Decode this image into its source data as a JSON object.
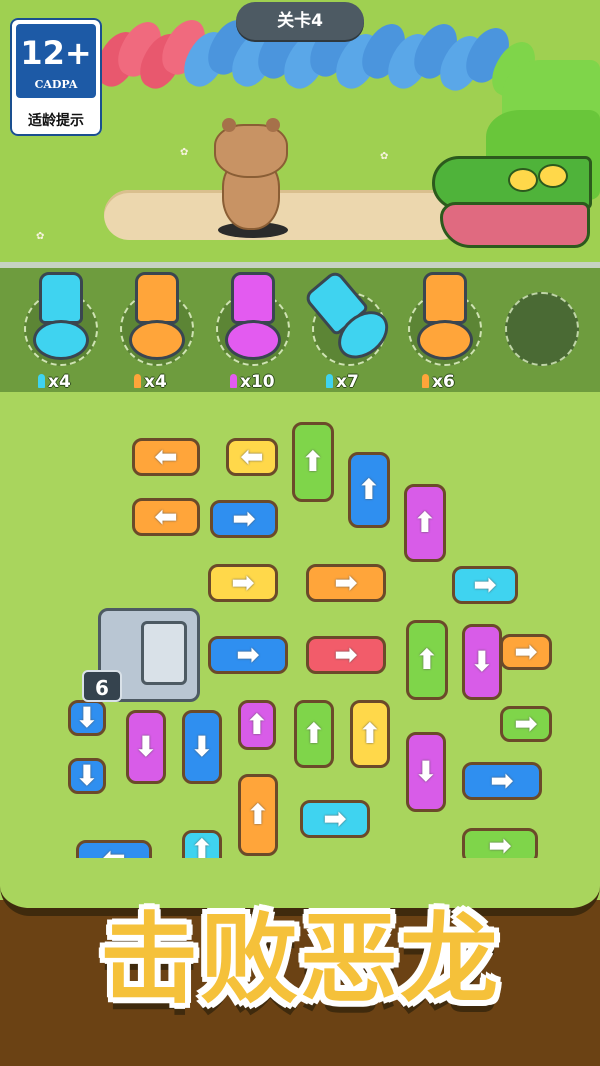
{
  "level_label": "关卡4",
  "age_badge": {
    "number": "12+",
    "org": "CADPA",
    "text": "适龄提示"
  },
  "cannons": [
    {
      "color": "#3fd3f0",
      "ammo": "x4"
    },
    {
      "color": "#ffa53a",
      "ammo": "x4"
    },
    {
      "color": "#e35bf0",
      "ammo": "x10"
    },
    {
      "color": "#3fd3f0",
      "ammo": "x7"
    },
    {
      "color": "#ffa53a",
      "ammo": "x6"
    }
  ],
  "box_cannon_count": "6",
  "banner": "击败恶龙",
  "colors": {
    "blue": "#2f8ff0",
    "red": "#f25c6a",
    "green": "#7fd54a",
    "yellow": "#ffd84a",
    "orange": "#ffa53a",
    "cyan": "#3fd3f0",
    "purple": "#d85ce8"
  },
  "tiles": [
    {
      "color": "orange",
      "dir": "left"
    },
    {
      "color": "yellow",
      "dir": "left"
    },
    {
      "color": "green",
      "dir": "up"
    },
    {
      "color": "blue",
      "dir": "up"
    },
    {
      "color": "orange",
      "dir": "left"
    },
    {
      "color": "blue",
      "dir": "right"
    },
    {
      "color": "purple",
      "dir": "up"
    },
    {
      "color": "yellow",
      "dir": "right"
    },
    {
      "color": "orange",
      "dir": "right"
    },
    {
      "color": "cyan",
      "dir": "right"
    },
    {
      "color": "blue",
      "dir": "right"
    },
    {
      "color": "red",
      "dir": "right"
    },
    {
      "color": "green",
      "dir": "up"
    },
    {
      "color": "purple",
      "dir": "down"
    },
    {
      "color": "orange",
      "dir": "right"
    },
    {
      "color": "blue",
      "dir": "down"
    },
    {
      "color": "purple",
      "dir": "down"
    },
    {
      "color": "blue",
      "dir": "down"
    },
    {
      "color": "purple",
      "dir": "up"
    },
    {
      "color": "green",
      "dir": "up"
    },
    {
      "color": "yellow",
      "dir": "up"
    },
    {
      "color": "green",
      "dir": "right"
    },
    {
      "color": "blue",
      "dir": "down"
    },
    {
      "color": "purple",
      "dir": "down"
    },
    {
      "color": "blue",
      "dir": "right"
    },
    {
      "color": "orange",
      "dir": "up"
    },
    {
      "color": "cyan",
      "dir": "right"
    },
    {
      "color": "blue",
      "dir": "left"
    },
    {
      "color": "cyan",
      "dir": "up"
    },
    {
      "color": "green",
      "dir": "right"
    }
  ]
}
